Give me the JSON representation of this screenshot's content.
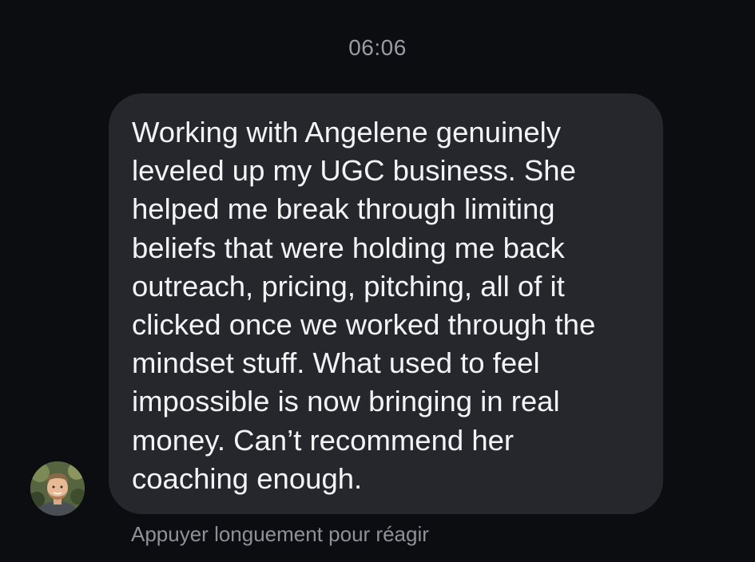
{
  "thread": {
    "timestamp": "06:06"
  },
  "message": {
    "text": "Working with Angelene genuinely\nleveled up my UGC business. She\nhelped me break through limiting\nbeliefs that were holding me back\noutreach, pricing, pitching, all of it\nclicked once we worked through the\nmindset stuff. What used to feel\nimpossible is now bringing in real\nmoney. Can’t recommend her\ncoaching enough."
  },
  "sender": {
    "avatar_icon": "user-avatar-photo"
  },
  "reaction_hint": "Appuyer longuement pour réagir",
  "colors": {
    "background": "#0c0d10",
    "bubble": "#26272c",
    "message_text": "#f4f4f6",
    "muted_text": "#9a9ca3"
  }
}
